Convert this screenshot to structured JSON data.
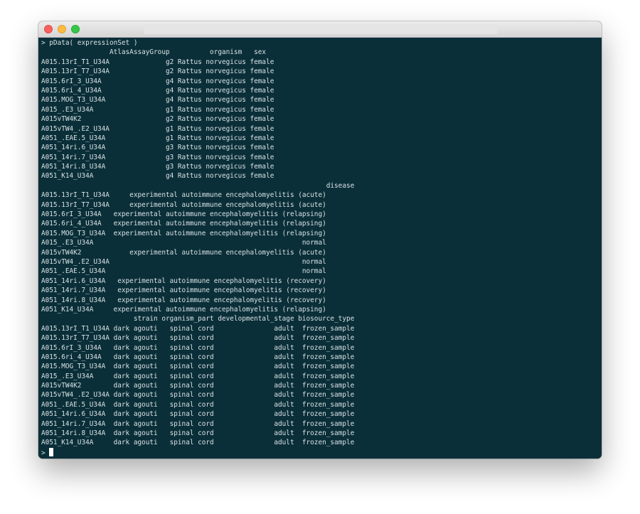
{
  "window": {
    "controls": {
      "close": "close-light",
      "minimize": "minimize-light",
      "zoom": "zoom-light"
    }
  },
  "terminal": {
    "colors": {
      "background": "#0b2f39",
      "text": "#d8e2e4",
      "cursor": "#ffffff"
    },
    "lines": [
      "> pData( expressionSet )",
      "                 AtlasAssayGroup          organism   sex",
      "A015.13rI_T1_U34A              g2 Rattus norvegicus female",
      "A015.13rI_T7_U34A              g2 Rattus norvegicus female",
      "A015.6rI_3_U34A                g4 Rattus norvegicus female",
      "A015.6ri_4_U34A                g4 Rattus norvegicus female",
      "A015.MOG_T3_U34A               g4 Rattus norvegicus female",
      "A015_.E3_U34A                  g1 Rattus norvegicus female",
      "A015vTW4K2                     g2 Rattus norvegicus female",
      "A015vTW4_.E2_U34A              g1 Rattus norvegicus female",
      "A051_.EAE.5_U34A               g1 Rattus norvegicus female",
      "A051_14ri.6_U34A               g3 Rattus norvegicus female",
      "A051_14ri.7_U34A               g3 Rattus norvegicus female",
      "A051_14ri.8_U34A               g3 Rattus norvegicus female",
      "A051_K14_U34A                  g4 Rattus norvegicus female",
      "                                                                       disease",
      "A015.13rI_T1_U34A     experimental autoimmune encephalomyelitis (acute)",
      "A015.13rI_T7_U34A     experimental autoimmune encephalomyelitis (acute)",
      "A015.6rI_3_U34A   experimental autoimmune encephalomyelitis (relapsing)",
      "A015.6ri_4_U34A   experimental autoimmune encephalomyelitis (relapsing)",
      "A015.MOG_T3_U34A  experimental autoimmune encephalomyelitis (relapsing)",
      "A015_.E3_U34A                                                    normal",
      "A015vTW4K2            experimental autoimmune encephalomyelitis (acute)",
      "A015vTW4_.E2_U34A                                                normal",
      "A051_.EAE.5_U34A                                                 normal",
      "A051_14ri.6_U34A   experimental autoimmune encephalomyelitis (recovery)",
      "A051_14ri.7_U34A   experimental autoimmune encephalomyelitis (recovery)",
      "A051_14ri.8_U34A   experimental autoimmune encephalomyelitis (recovery)",
      "A051_K14_U34A     experimental autoimmune encephalomyelitis (relapsing)",
      "                       strain organism_part developmental_stage biosource_type",
      "A015.13rI_T1_U34A dark agouti   spinal cord               adult  frozen_sample",
      "A015.13rI_T7_U34A dark agouti   spinal cord               adult  frozen_sample",
      "A015.6rI_3_U34A   dark agouti   spinal cord               adult  frozen_sample",
      "A015.6ri_4_U34A   dark agouti   spinal cord               adult  frozen_sample",
      "A015.MOG_T3_U34A  dark agouti   spinal cord               adult  frozen_sample",
      "A015_.E3_U34A     dark agouti   spinal cord               adult  frozen_sample",
      "A015vTW4K2        dark agouti   spinal cord               adult  frozen_sample",
      "A015vTW4_.E2_U34A dark agouti   spinal cord               adult  frozen_sample",
      "A051_.EAE.5_U34A  dark agouti   spinal cord               adult  frozen_sample",
      "A051_14ri.6_U34A  dark agouti   spinal cord               adult  frozen_sample",
      "A051_14ri.7_U34A  dark agouti   spinal cord               adult  frozen_sample",
      "A051_14ri.8_U34A  dark agouti   spinal cord               adult  frozen_sample",
      "A051_K14_U34A     dark agouti   spinal cord               adult  frozen_sample"
    ],
    "prompt": "> "
  }
}
